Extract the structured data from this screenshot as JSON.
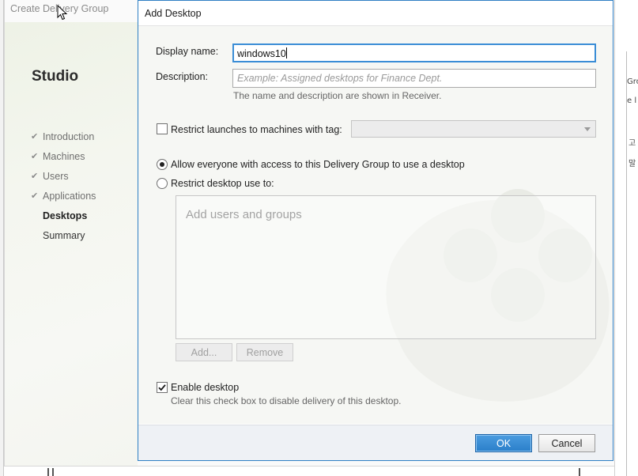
{
  "background": {
    "right_texts": [
      "Gro",
      "e l",
      "고",
      "말"
    ]
  },
  "wizard": {
    "title": "Create Delivery Group",
    "studio_title": "Studio",
    "steps": [
      {
        "label": "Introduction",
        "state": "completed"
      },
      {
        "label": "Machines",
        "state": "completed"
      },
      {
        "label": "Users",
        "state": "completed"
      },
      {
        "label": "Applications",
        "state": "completed"
      },
      {
        "label": "Desktops",
        "state": "current"
      },
      {
        "label": "Summary",
        "state": "pending"
      }
    ],
    "check_glyph": "✔"
  },
  "dialog": {
    "title": "Add Desktop",
    "display_name_label": "Display name:",
    "display_name_value": "windows10",
    "description_label": "Description:",
    "description_placeholder": "Example: Assigned desktops for Finance Dept.",
    "name_hint": "The name and description are shown in Receiver.",
    "restrict_tag_label": "Restrict launches to machines with tag:",
    "restrict_tag_checked": false,
    "tag_select_value": "",
    "radio_allow_label": "Allow everyone with access to this Delivery Group to use a desktop",
    "radio_allow_selected": true,
    "radio_restrict_label": "Restrict desktop use to:",
    "radio_restrict_selected": false,
    "users_placeholder": "Add users and groups",
    "add_button": "Add...",
    "remove_button": "Remove",
    "enable_desktop_label": "Enable desktop",
    "enable_desktop_checked": true,
    "enable_desktop_hint": "Clear this check box to disable delivery of this desktop.",
    "ok_button": "OK",
    "cancel_button": "Cancel",
    "accent_color": "#2a7fc9"
  }
}
